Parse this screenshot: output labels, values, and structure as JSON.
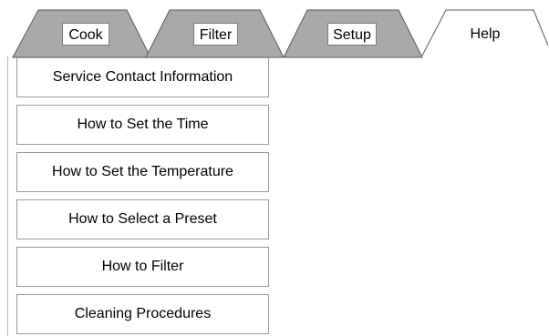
{
  "tabs": [
    {
      "label": "Cook",
      "active": false
    },
    {
      "label": "Filter",
      "active": false
    },
    {
      "label": "Setup",
      "active": false
    },
    {
      "label": "Help",
      "active": true
    }
  ],
  "help_menu": {
    "items": [
      {
        "label": "Service Contact Information"
      },
      {
        "label": "How to Set the Time"
      },
      {
        "label": "How to Set the Temperature"
      },
      {
        "label": "How to Select a Preset"
      },
      {
        "label": "How to Filter"
      },
      {
        "label": "Cleaning Procedures"
      }
    ]
  },
  "colors": {
    "inactive_tab_fill": "#a9a9a9",
    "tab_outline": "#5a5a5a",
    "active_tab_fill": "#ffffff",
    "button_border": "#9a9a9a"
  }
}
